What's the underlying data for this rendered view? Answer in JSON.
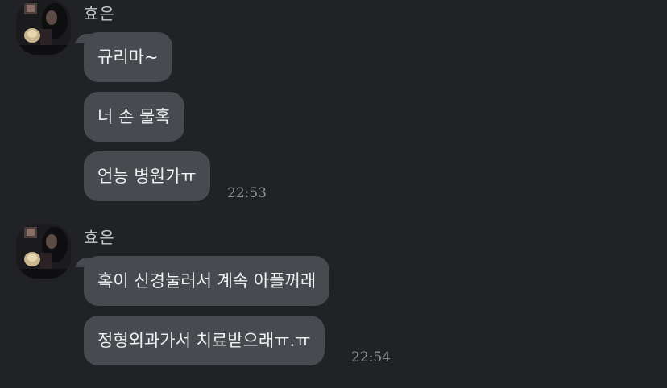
{
  "groups": [
    {
      "sender": "효은",
      "avatar_icon": "profile-photo",
      "messages": [
        {
          "text": "규리마~"
        },
        {
          "text": "너 손 물혹"
        },
        {
          "text": "언능 병원가ㅠ",
          "time": "22:53"
        }
      ]
    },
    {
      "sender": "효은",
      "avatar_icon": "profile-photo",
      "messages": [
        {
          "text": "혹이 신경눌러서 계속 아플꺼래"
        },
        {
          "text": "정형외과가서 치료받으래ㅠ.ㅠ",
          "time": "22:54"
        }
      ]
    }
  ],
  "colors": {
    "background": "#212226",
    "bubble": "#484a50",
    "text": "#f0f1f3",
    "sender": "#c9cacd",
    "time": "#8e9096"
  }
}
